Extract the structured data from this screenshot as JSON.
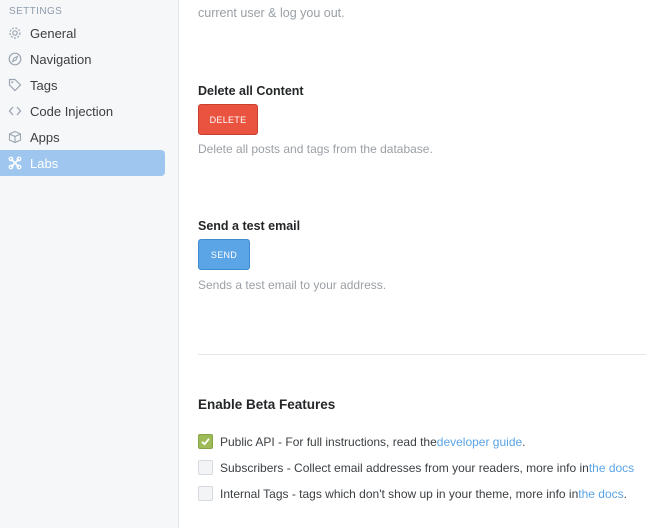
{
  "sidebar": {
    "heading": "SETTINGS",
    "items": [
      {
        "label": "General",
        "icon": "gear-icon"
      },
      {
        "label": "Navigation",
        "icon": "compass-icon"
      },
      {
        "label": "Tags",
        "icon": "tag-icon"
      },
      {
        "label": "Code Injection",
        "icon": "code-icon"
      },
      {
        "label": "Apps",
        "icon": "box-icon"
      },
      {
        "label": "Labs",
        "icon": "labs-icon",
        "active": true
      }
    ]
  },
  "main": {
    "top_text": "current user & log you out.",
    "delete_section": {
      "title": "Delete all Content",
      "button": "DELETE",
      "help": "Delete all posts and tags from the database."
    },
    "email_section": {
      "title": "Send a test email",
      "button": "SEND",
      "help": "Sends a test email to your address."
    },
    "beta": {
      "title": "Enable Beta Features",
      "features": [
        {
          "text": "Public API - For full instructions, read the ",
          "link": "developer guide",
          "suffix": ".",
          "checked": true
        },
        {
          "text": "Subscribers - Collect email addresses from your readers, more info in ",
          "link": "the docs",
          "suffix": "",
          "checked": false
        },
        {
          "text": "Internal Tags - tags which don't show up in your theme, more info in ",
          "link": "the docs",
          "suffix": ".",
          "checked": false
        }
      ]
    }
  },
  "colors": {
    "accent_blue": "#5ba4e5",
    "danger_red": "#e9533f",
    "active_nav": "#9ec6ef",
    "check_green": "#9fbb58"
  }
}
